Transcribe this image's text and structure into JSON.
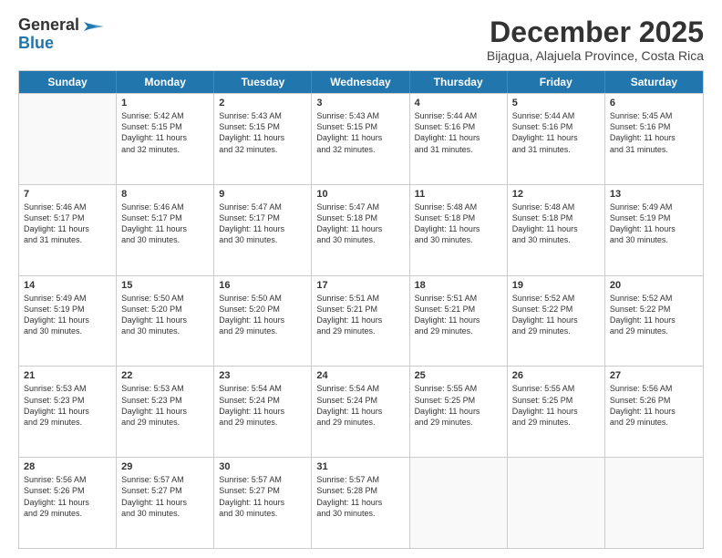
{
  "logo": {
    "general": "General",
    "blue": "Blue"
  },
  "title": "December 2025",
  "subtitle": "Bijagua, Alajuela Province, Costa Rica",
  "header_days": [
    "Sunday",
    "Monday",
    "Tuesday",
    "Wednesday",
    "Thursday",
    "Friday",
    "Saturday"
  ],
  "weeks": [
    [
      {
        "day": "",
        "empty": true,
        "text": ""
      },
      {
        "day": "1",
        "empty": false,
        "text": "Sunrise: 5:42 AM\nSunset: 5:15 PM\nDaylight: 11 hours\nand 32 minutes."
      },
      {
        "day": "2",
        "empty": false,
        "text": "Sunrise: 5:43 AM\nSunset: 5:15 PM\nDaylight: 11 hours\nand 32 minutes."
      },
      {
        "day": "3",
        "empty": false,
        "text": "Sunrise: 5:43 AM\nSunset: 5:15 PM\nDaylight: 11 hours\nand 32 minutes."
      },
      {
        "day": "4",
        "empty": false,
        "text": "Sunrise: 5:44 AM\nSunset: 5:16 PM\nDaylight: 11 hours\nand 31 minutes."
      },
      {
        "day": "5",
        "empty": false,
        "text": "Sunrise: 5:44 AM\nSunset: 5:16 PM\nDaylight: 11 hours\nand 31 minutes."
      },
      {
        "day": "6",
        "empty": false,
        "text": "Sunrise: 5:45 AM\nSunset: 5:16 PM\nDaylight: 11 hours\nand 31 minutes."
      }
    ],
    [
      {
        "day": "7",
        "empty": false,
        "text": "Sunrise: 5:46 AM\nSunset: 5:17 PM\nDaylight: 11 hours\nand 31 minutes."
      },
      {
        "day": "8",
        "empty": false,
        "text": "Sunrise: 5:46 AM\nSunset: 5:17 PM\nDaylight: 11 hours\nand 30 minutes."
      },
      {
        "day": "9",
        "empty": false,
        "text": "Sunrise: 5:47 AM\nSunset: 5:17 PM\nDaylight: 11 hours\nand 30 minutes."
      },
      {
        "day": "10",
        "empty": false,
        "text": "Sunrise: 5:47 AM\nSunset: 5:18 PM\nDaylight: 11 hours\nand 30 minutes."
      },
      {
        "day": "11",
        "empty": false,
        "text": "Sunrise: 5:48 AM\nSunset: 5:18 PM\nDaylight: 11 hours\nand 30 minutes."
      },
      {
        "day": "12",
        "empty": false,
        "text": "Sunrise: 5:48 AM\nSunset: 5:18 PM\nDaylight: 11 hours\nand 30 minutes."
      },
      {
        "day": "13",
        "empty": false,
        "text": "Sunrise: 5:49 AM\nSunset: 5:19 PM\nDaylight: 11 hours\nand 30 minutes."
      }
    ],
    [
      {
        "day": "14",
        "empty": false,
        "text": "Sunrise: 5:49 AM\nSunset: 5:19 PM\nDaylight: 11 hours\nand 30 minutes."
      },
      {
        "day": "15",
        "empty": false,
        "text": "Sunrise: 5:50 AM\nSunset: 5:20 PM\nDaylight: 11 hours\nand 30 minutes."
      },
      {
        "day": "16",
        "empty": false,
        "text": "Sunrise: 5:50 AM\nSunset: 5:20 PM\nDaylight: 11 hours\nand 29 minutes."
      },
      {
        "day": "17",
        "empty": false,
        "text": "Sunrise: 5:51 AM\nSunset: 5:21 PM\nDaylight: 11 hours\nand 29 minutes."
      },
      {
        "day": "18",
        "empty": false,
        "text": "Sunrise: 5:51 AM\nSunset: 5:21 PM\nDaylight: 11 hours\nand 29 minutes."
      },
      {
        "day": "19",
        "empty": false,
        "text": "Sunrise: 5:52 AM\nSunset: 5:22 PM\nDaylight: 11 hours\nand 29 minutes."
      },
      {
        "day": "20",
        "empty": false,
        "text": "Sunrise: 5:52 AM\nSunset: 5:22 PM\nDaylight: 11 hours\nand 29 minutes."
      }
    ],
    [
      {
        "day": "21",
        "empty": false,
        "text": "Sunrise: 5:53 AM\nSunset: 5:23 PM\nDaylight: 11 hours\nand 29 minutes."
      },
      {
        "day": "22",
        "empty": false,
        "text": "Sunrise: 5:53 AM\nSunset: 5:23 PM\nDaylight: 11 hours\nand 29 minutes."
      },
      {
        "day": "23",
        "empty": false,
        "text": "Sunrise: 5:54 AM\nSunset: 5:24 PM\nDaylight: 11 hours\nand 29 minutes."
      },
      {
        "day": "24",
        "empty": false,
        "text": "Sunrise: 5:54 AM\nSunset: 5:24 PM\nDaylight: 11 hours\nand 29 minutes."
      },
      {
        "day": "25",
        "empty": false,
        "text": "Sunrise: 5:55 AM\nSunset: 5:25 PM\nDaylight: 11 hours\nand 29 minutes."
      },
      {
        "day": "26",
        "empty": false,
        "text": "Sunrise: 5:55 AM\nSunset: 5:25 PM\nDaylight: 11 hours\nand 29 minutes."
      },
      {
        "day": "27",
        "empty": false,
        "text": "Sunrise: 5:56 AM\nSunset: 5:26 PM\nDaylight: 11 hours\nand 29 minutes."
      }
    ],
    [
      {
        "day": "28",
        "empty": false,
        "text": "Sunrise: 5:56 AM\nSunset: 5:26 PM\nDaylight: 11 hours\nand 29 minutes."
      },
      {
        "day": "29",
        "empty": false,
        "text": "Sunrise: 5:57 AM\nSunset: 5:27 PM\nDaylight: 11 hours\nand 30 minutes."
      },
      {
        "day": "30",
        "empty": false,
        "text": "Sunrise: 5:57 AM\nSunset: 5:27 PM\nDaylight: 11 hours\nand 30 minutes."
      },
      {
        "day": "31",
        "empty": false,
        "text": "Sunrise: 5:57 AM\nSunset: 5:28 PM\nDaylight: 11 hours\nand 30 minutes."
      },
      {
        "day": "",
        "empty": true,
        "text": ""
      },
      {
        "day": "",
        "empty": true,
        "text": ""
      },
      {
        "day": "",
        "empty": true,
        "text": ""
      }
    ]
  ]
}
